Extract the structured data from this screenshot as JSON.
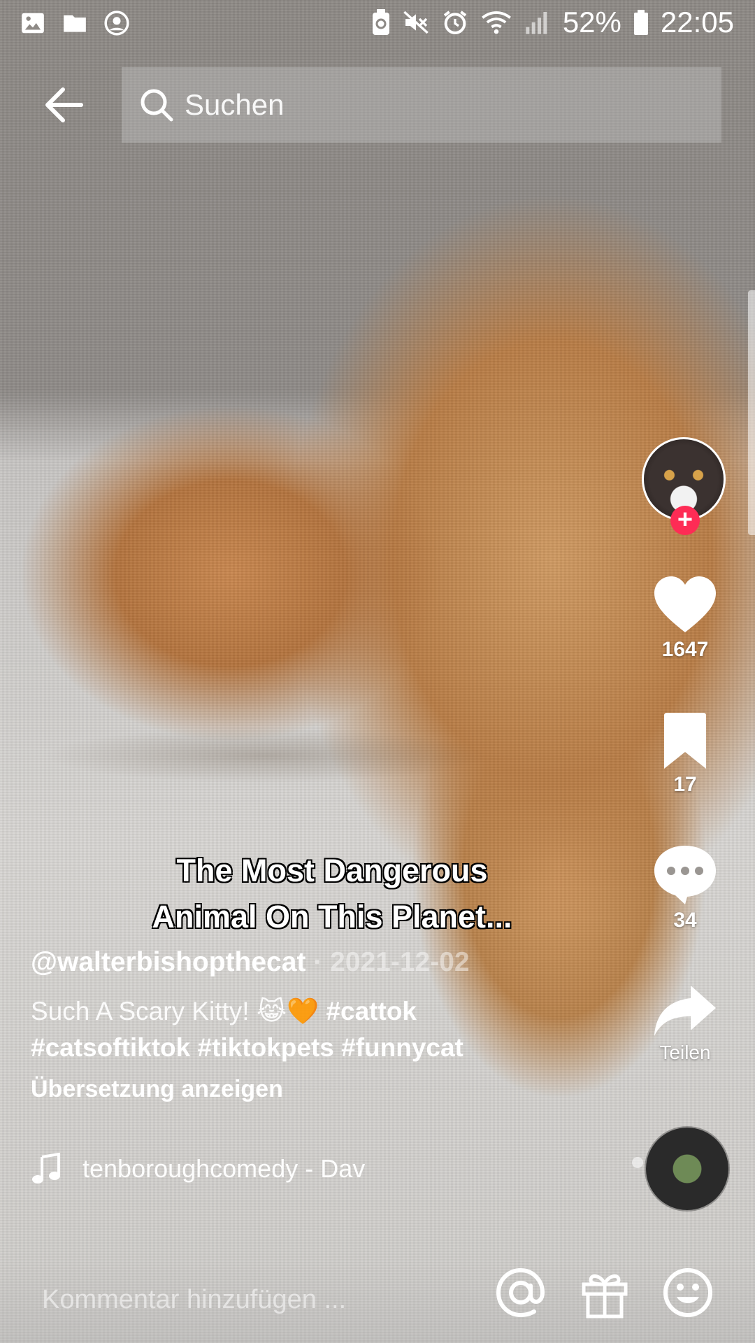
{
  "status_bar": {
    "battery": "52%",
    "time": "22:05",
    "left_icons": [
      "gallery-icon",
      "folder-icon",
      "account-icon"
    ],
    "right_icons": [
      "battery-saver-icon",
      "mute-icon",
      "alarm-icon",
      "wifi-icon",
      "signal-icon",
      "battery-icon"
    ]
  },
  "top_bar": {
    "back_icon": "arrow-left-icon",
    "search_placeholder": "Suchen"
  },
  "actions": {
    "likes": "1647",
    "bookmarks": "17",
    "comments": "34",
    "share_label": "Teilen"
  },
  "video": {
    "caption_line1": "The Most Dangerous",
    "caption_line2": "Animal On This Planet..."
  },
  "post": {
    "author": "@walterbishopthecat",
    "separator": " · ",
    "date": "2021-12-02",
    "description_text": "Such A Scary Kitty!  😹🧡 ",
    "hashtags_line1": "#cattok",
    "hashtags_line2": "#catsoftiktok #tiktokpets #funnycat",
    "translate_label": "Übersetzung anzeigen",
    "music": "tenboroughcomedy - Dav"
  },
  "comment_bar": {
    "placeholder": "Kommentar hinzufügen ..."
  },
  "colors": {
    "accent": "#fe2c55",
    "text": "#ffffff"
  }
}
